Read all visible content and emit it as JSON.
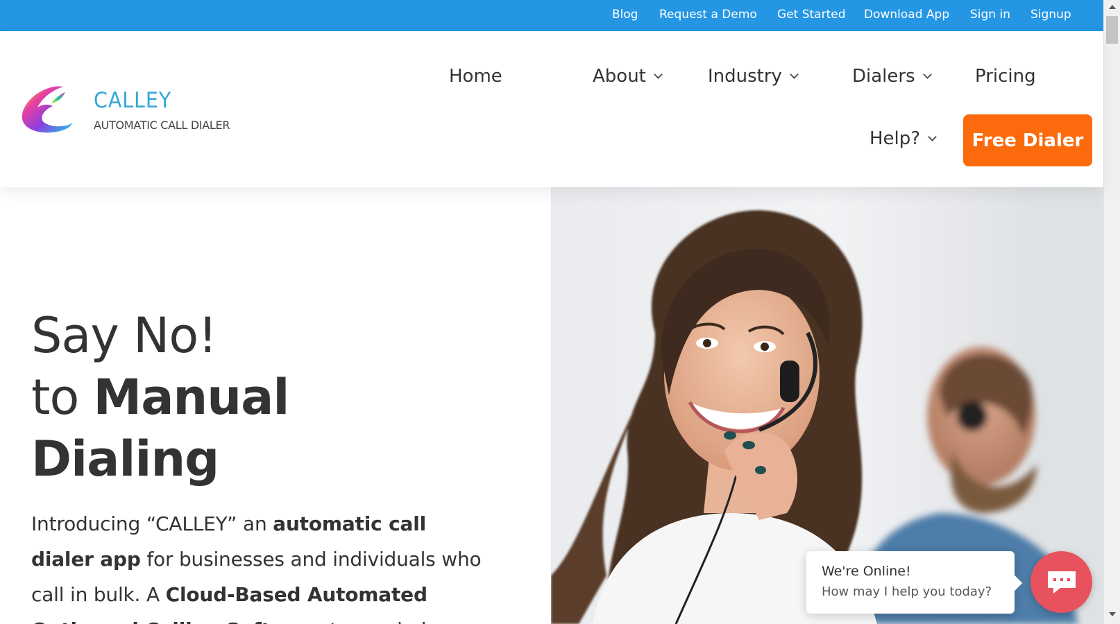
{
  "topbar": {
    "links": [
      "Blog",
      "Request a Demo",
      "Get Started",
      "Download App",
      "Sign in",
      "Signup"
    ]
  },
  "logo": {
    "name": "CALLEY",
    "tagline": "AUTOMATIC CALL DIALER"
  },
  "nav": {
    "home": "Home",
    "about": "About",
    "industry": "Industry",
    "dialers": "Dialers",
    "pricing": "Pricing",
    "help": "Help?",
    "cta": "Free Dialer"
  },
  "hero": {
    "line1": "Say No!",
    "line2_prefix": "to ",
    "line2_bold": "Manual",
    "line3_bold": "Dialing",
    "intro_1": "Introducing “CALLEY” an ",
    "intro_2_bold": "automatic call dialer app",
    "intro_3": " for businesses and individuals who call in bulk. A ",
    "intro_4_bold": "Cloud-Based Automated Outbound Calling Software",
    "intro_5": " to maximize"
  },
  "chat": {
    "status": "We're Online!",
    "prompt": "How may I help you today?"
  },
  "colors": {
    "topbar": "#2596e4",
    "cta": "#fb6b0d",
    "chat_button": "#e8525f",
    "logo_text": "#33a8d8"
  }
}
